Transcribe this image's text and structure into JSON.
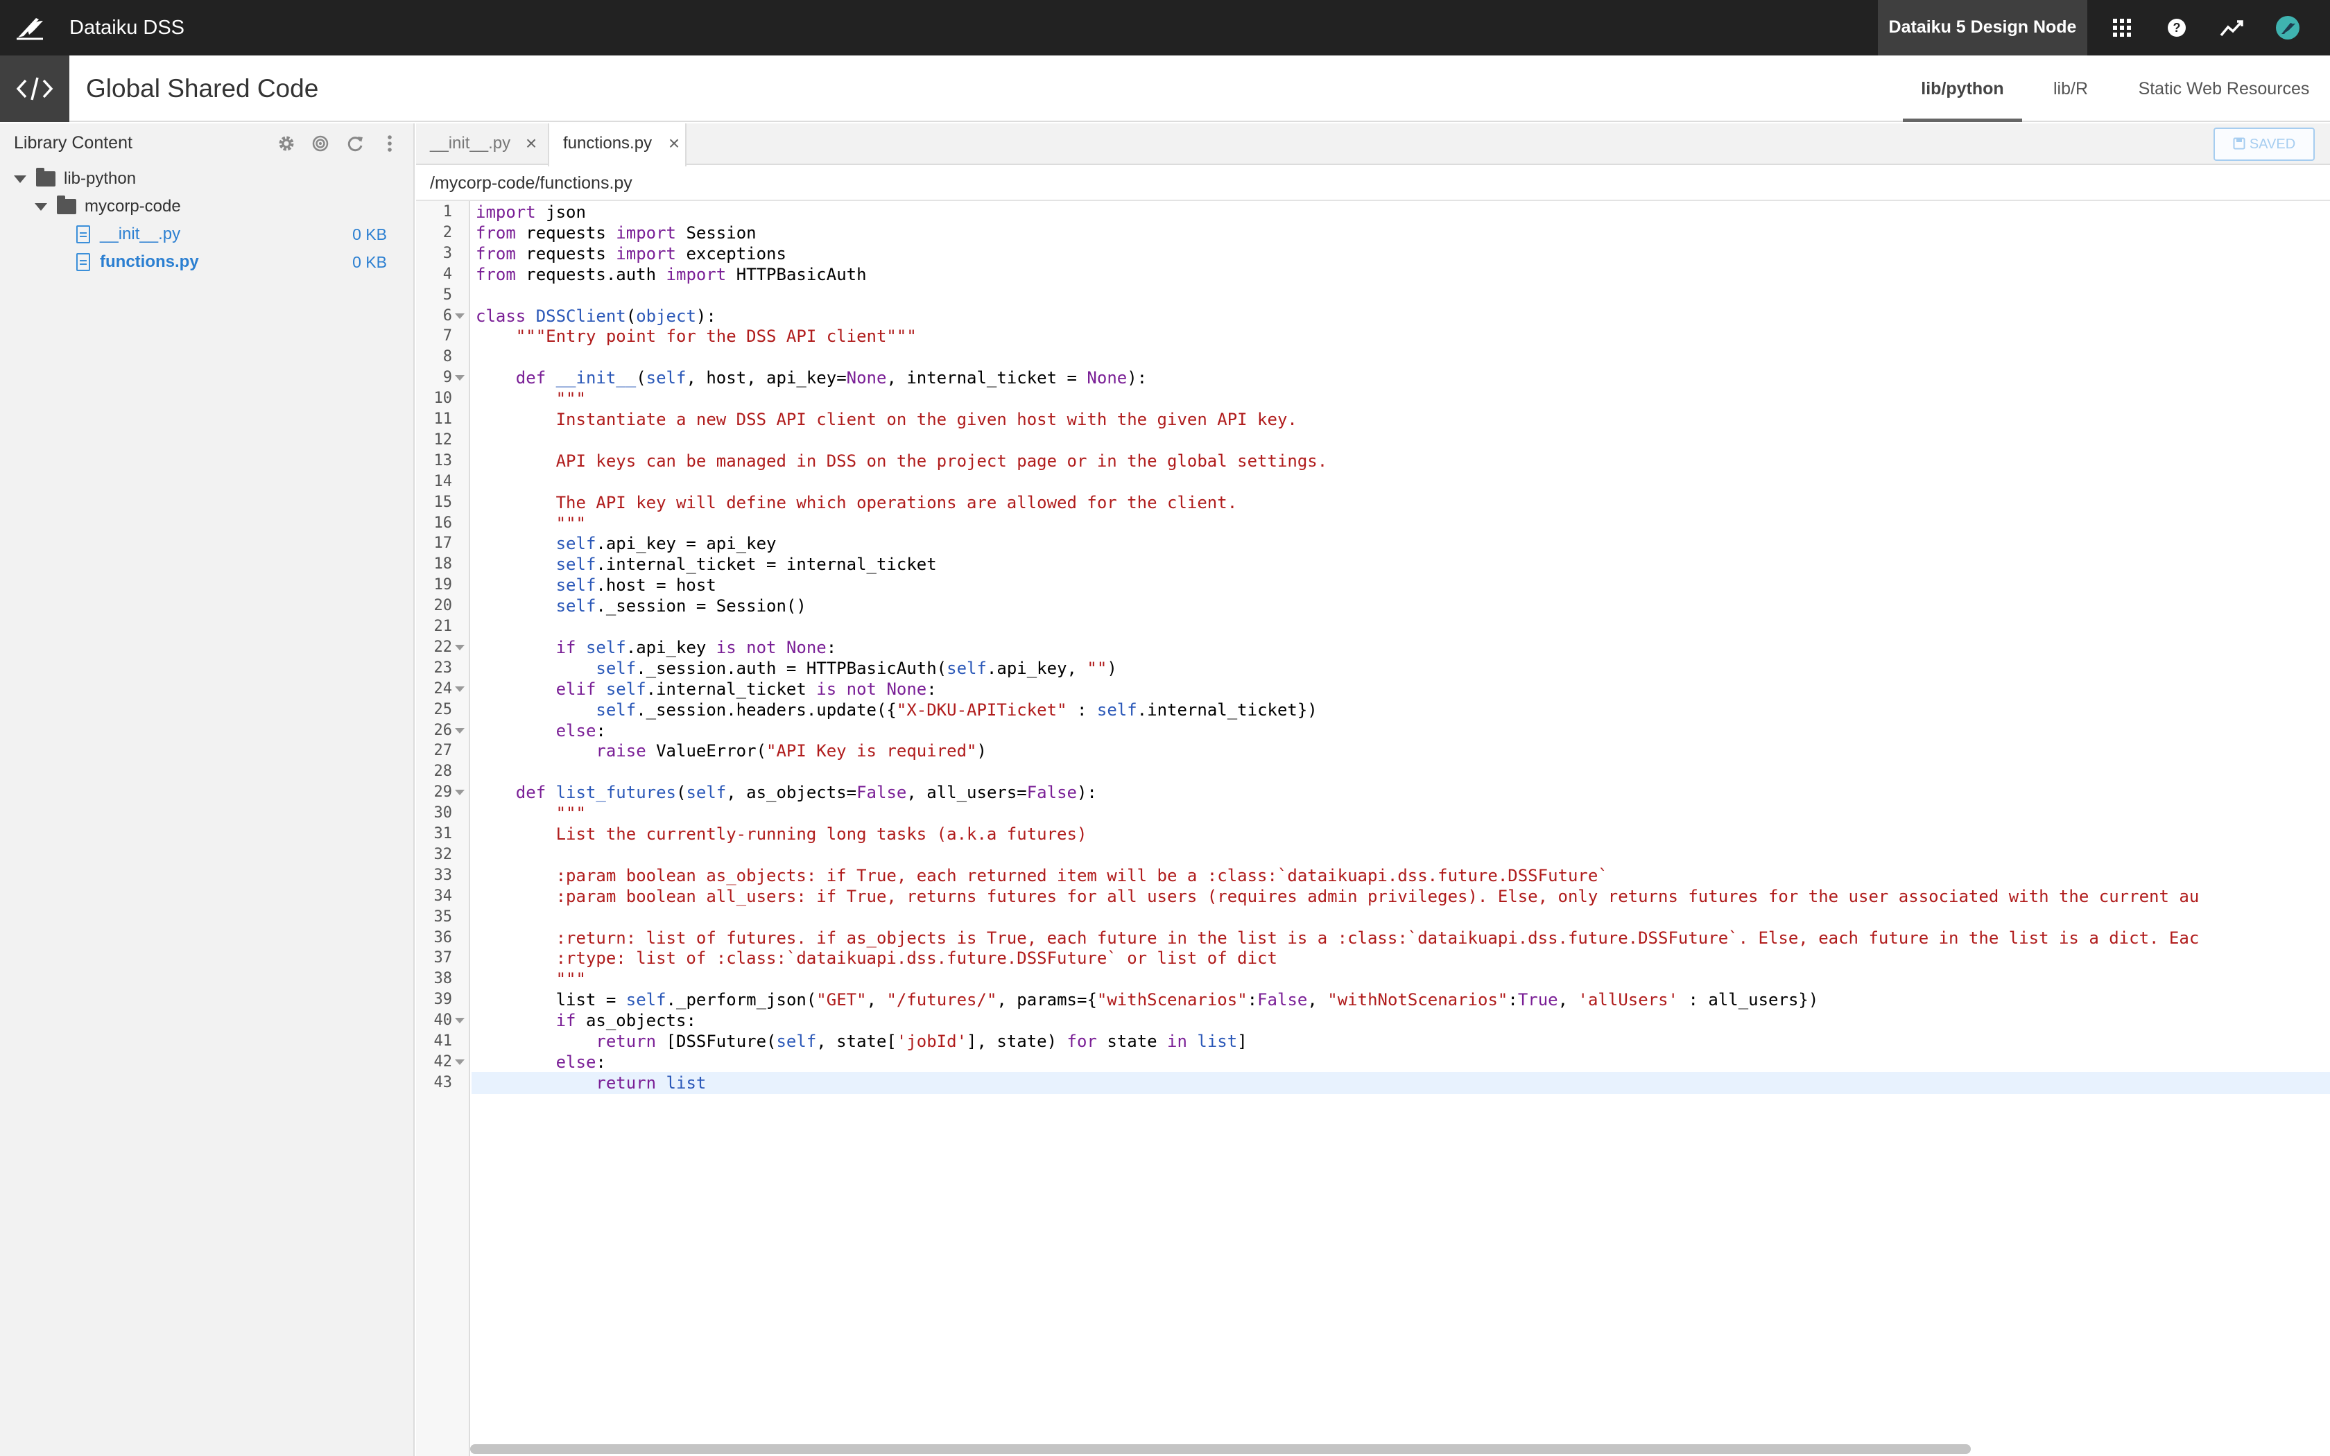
{
  "app": {
    "title": "Dataiku DSS",
    "node_label": "Dataiku 5 Design Node",
    "nav_icons": [
      "apps-grid-icon",
      "help-icon",
      "activity-icon",
      "profile-avatar-icon"
    ]
  },
  "header": {
    "title": "Global Shared Code",
    "icon": "code-brackets-icon",
    "tabs": [
      {
        "label": "lib/python",
        "active": true
      },
      {
        "label": "lib/R",
        "active": false
      },
      {
        "label": "Static Web Resources",
        "active": false
      }
    ]
  },
  "sidebar": {
    "title": "Library Content",
    "tools": [
      "gear-icon",
      "target-icon",
      "refresh-icon",
      "more-vertical-icon"
    ],
    "tree": [
      {
        "label": "lib-python",
        "type": "folder",
        "depth": 0
      },
      {
        "label": "mycorp-code",
        "type": "folder",
        "depth": 1
      },
      {
        "label": "__init__.py",
        "type": "file",
        "depth": 2,
        "size": "0 KB",
        "selected": false
      },
      {
        "label": "functions.py",
        "type": "file",
        "depth": 2,
        "size": "0 KB",
        "selected": true
      }
    ]
  },
  "editor": {
    "tabs": [
      {
        "label": "__init__.py",
        "active": false
      },
      {
        "label": "functions.py",
        "active": true
      }
    ],
    "saved_label": "SAVED",
    "file_path": "/mycorp-code/functions.py",
    "active_line": 43,
    "fold_lines": [
      6,
      9,
      22,
      24,
      26,
      29,
      40,
      42
    ],
    "lines": [
      [
        [
          "kw",
          "import"
        ],
        [
          "p",
          " json"
        ]
      ],
      [
        [
          "kw",
          "from"
        ],
        [
          "p",
          " requests "
        ],
        [
          "kw",
          "import"
        ],
        [
          "p",
          " Session"
        ]
      ],
      [
        [
          "kw",
          "from"
        ],
        [
          "p",
          " requests "
        ],
        [
          "kw",
          "import"
        ],
        [
          "p",
          " exceptions"
        ]
      ],
      [
        [
          "kw",
          "from"
        ],
        [
          "p",
          " requests.auth "
        ],
        [
          "kw",
          "import"
        ],
        [
          "p",
          " HTTPBasicAuth"
        ]
      ],
      [],
      [
        [
          "kw",
          "class"
        ],
        [
          "p",
          " "
        ],
        [
          "b",
          "DSSClient"
        ],
        [
          "p",
          "("
        ],
        [
          "b",
          "object"
        ],
        [
          "p",
          "):"
        ]
      ],
      [
        [
          "p",
          "    "
        ],
        [
          "s",
          "\"\"\"Entry point for the DSS API client\"\"\""
        ]
      ],
      [],
      [
        [
          "p",
          "    "
        ],
        [
          "kw",
          "def"
        ],
        [
          "p",
          " "
        ],
        [
          "b",
          "__init__"
        ],
        [
          "p",
          "("
        ],
        [
          "b",
          "self"
        ],
        [
          "p",
          ", host, api_key="
        ],
        [
          "kw",
          "None"
        ],
        [
          "p",
          ", internal_ticket = "
        ],
        [
          "kw",
          "None"
        ],
        [
          "p",
          "):"
        ]
      ],
      [
        [
          "p",
          "        "
        ],
        [
          "s",
          "\"\"\""
        ]
      ],
      [
        [
          "p",
          "        "
        ],
        [
          "s",
          "Instantiate a new DSS API client on the given host with the given API key."
        ]
      ],
      [],
      [
        [
          "p",
          "        "
        ],
        [
          "s",
          "API keys can be managed in DSS on the project page or in the global settings."
        ]
      ],
      [],
      [
        [
          "p",
          "        "
        ],
        [
          "s",
          "The API key will define which operations are allowed for the client."
        ]
      ],
      [
        [
          "p",
          "        "
        ],
        [
          "s",
          "\"\"\""
        ]
      ],
      [
        [
          "p",
          "        "
        ],
        [
          "b",
          "self"
        ],
        [
          "p",
          ".api_key = api_key"
        ]
      ],
      [
        [
          "p",
          "        "
        ],
        [
          "b",
          "self"
        ],
        [
          "p",
          ".internal_ticket = internal_ticket"
        ]
      ],
      [
        [
          "p",
          "        "
        ],
        [
          "b",
          "self"
        ],
        [
          "p",
          ".host = host"
        ]
      ],
      [
        [
          "p",
          "        "
        ],
        [
          "b",
          "self"
        ],
        [
          "p",
          "._session = Session()"
        ]
      ],
      [],
      [
        [
          "p",
          "        "
        ],
        [
          "kw",
          "if"
        ],
        [
          "p",
          " "
        ],
        [
          "b",
          "self"
        ],
        [
          "p",
          ".api_key "
        ],
        [
          "kw",
          "is not"
        ],
        [
          "p",
          " "
        ],
        [
          "kw",
          "None"
        ],
        [
          "p",
          ":"
        ]
      ],
      [
        [
          "p",
          "            "
        ],
        [
          "b",
          "self"
        ],
        [
          "p",
          "._session.auth = HTTPBasicAuth("
        ],
        [
          "b",
          "self"
        ],
        [
          "p",
          ".api_key, "
        ],
        [
          "s",
          "\"\""
        ],
        [
          "p",
          ")"
        ]
      ],
      [
        [
          "p",
          "        "
        ],
        [
          "kw",
          "elif"
        ],
        [
          "p",
          " "
        ],
        [
          "b",
          "self"
        ],
        [
          "p",
          ".internal_ticket "
        ],
        [
          "kw",
          "is not"
        ],
        [
          "p",
          " "
        ],
        [
          "kw",
          "None"
        ],
        [
          "p",
          ":"
        ]
      ],
      [
        [
          "p",
          "            "
        ],
        [
          "b",
          "self"
        ],
        [
          "p",
          "._session.headers.update({"
        ],
        [
          "s",
          "\"X-DKU-APITicket\""
        ],
        [
          "p",
          " : "
        ],
        [
          "b",
          "self"
        ],
        [
          "p",
          ".internal_ticket})"
        ]
      ],
      [
        [
          "p",
          "        "
        ],
        [
          "kw",
          "else"
        ],
        [
          "p",
          ":"
        ]
      ],
      [
        [
          "p",
          "            "
        ],
        [
          "kw",
          "raise"
        ],
        [
          "p",
          " ValueError("
        ],
        [
          "s",
          "\"API Key is required\""
        ],
        [
          "p",
          ")"
        ]
      ],
      [],
      [
        [
          "p",
          "    "
        ],
        [
          "kw",
          "def"
        ],
        [
          "p",
          " "
        ],
        [
          "b",
          "list_futures"
        ],
        [
          "p",
          "("
        ],
        [
          "b",
          "self"
        ],
        [
          "p",
          ", as_objects="
        ],
        [
          "kw",
          "False"
        ],
        [
          "p",
          ", all_users="
        ],
        [
          "kw",
          "False"
        ],
        [
          "p",
          "):"
        ]
      ],
      [
        [
          "p",
          "        "
        ],
        [
          "s",
          "\"\"\""
        ]
      ],
      [
        [
          "p",
          "        "
        ],
        [
          "s",
          "List the currently-running long tasks (a.k.a futures)"
        ]
      ],
      [],
      [
        [
          "p",
          "        "
        ],
        [
          "s",
          ":param boolean as_objects: if True, each returned item will be a :class:`dataikuapi.dss.future.DSSFuture`"
        ]
      ],
      [
        [
          "p",
          "        "
        ],
        [
          "s",
          ":param boolean all_users: if True, returns futures for all users (requires admin privileges). Else, only returns futures for the user associated with the current au"
        ]
      ],
      [],
      [
        [
          "p",
          "        "
        ],
        [
          "s",
          ":return: list of futures. if as_objects is True, each future in the list is a :class:`dataikuapi.dss.future.DSSFuture`. Else, each future in the list is a dict. Eac"
        ]
      ],
      [
        [
          "p",
          "        "
        ],
        [
          "s",
          ":rtype: list of :class:`dataikuapi.dss.future.DSSFuture` or list of dict"
        ]
      ],
      [
        [
          "p",
          "        "
        ],
        [
          "s",
          "\"\"\""
        ]
      ],
      [
        [
          "p",
          "        list = "
        ],
        [
          "b",
          "self"
        ],
        [
          "p",
          "._perform_json("
        ],
        [
          "s",
          "\"GET\""
        ],
        [
          "p",
          ", "
        ],
        [
          "s",
          "\"/futures/\""
        ],
        [
          "p",
          ", params={"
        ],
        [
          "s",
          "\"withScenarios\""
        ],
        [
          "p",
          ":"
        ],
        [
          "kw",
          "False"
        ],
        [
          "p",
          ", "
        ],
        [
          "s",
          "\"withNotScenarios\""
        ],
        [
          "p",
          ":"
        ],
        [
          "kw",
          "True"
        ],
        [
          "p",
          ", "
        ],
        [
          "s",
          "'allUsers'"
        ],
        [
          "p",
          " : all_users})"
        ]
      ],
      [
        [
          "p",
          "        "
        ],
        [
          "kw",
          "if"
        ],
        [
          "p",
          " as_objects:"
        ]
      ],
      [
        [
          "p",
          "            "
        ],
        [
          "kw",
          "return"
        ],
        [
          "p",
          " [DSSFuture("
        ],
        [
          "b",
          "self"
        ],
        [
          "p",
          ", state["
        ],
        [
          "s",
          "'jobId'"
        ],
        [
          "p",
          "], state) "
        ],
        [
          "kw",
          "for"
        ],
        [
          "p",
          " state "
        ],
        [
          "kw",
          "in"
        ],
        [
          "p",
          " "
        ],
        [
          "b",
          "list"
        ],
        [
          "p",
          "]"
        ]
      ],
      [
        [
          "p",
          "        "
        ],
        [
          "kw",
          "else"
        ],
        [
          "p",
          ":"
        ]
      ],
      [
        [
          "p",
          "            "
        ],
        [
          "kw",
          "return"
        ],
        [
          "p",
          " "
        ],
        [
          "b",
          "list"
        ]
      ]
    ]
  }
}
